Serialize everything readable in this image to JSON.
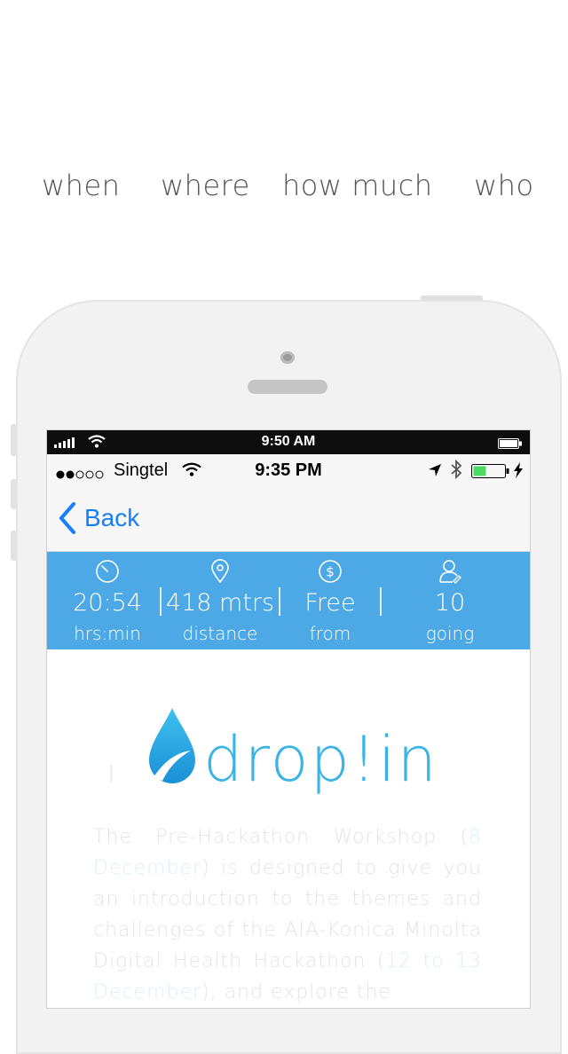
{
  "headline": {
    "items": [
      "when",
      "where",
      "how much",
      "who"
    ]
  },
  "device_statusbar": {
    "time": "9:50 AM"
  },
  "app_statusbar": {
    "carrier": "Singtel",
    "time": "9:35 PM"
  },
  "navbar": {
    "back_label": "Back"
  },
  "stats": [
    {
      "icon": "clock-icon",
      "value": "20:54",
      "label": "hrs:min"
    },
    {
      "icon": "location-pin-icon",
      "value": "418 mtrs",
      "label": "distance"
    },
    {
      "icon": "dollar-coin-icon",
      "value": "Free",
      "label": "from"
    },
    {
      "icon": "person-icon",
      "value": "10",
      "label": "going"
    }
  ],
  "content": {
    "logo_text": "drop!in",
    "description": {
      "p1": "The Pre-Hackathon Workshop (",
      "d1": "8 December",
      "p2": ") is designed to give you an introduction to the themes and challenges of the AIA-Konica Minolta Digital Health Hackathon (",
      "d2": "12 to 13 December",
      "p3": "), and explore the"
    }
  },
  "colors": {
    "accent": "#4ca9e6",
    "link": "#157efb",
    "logo": "#3ab4e8"
  }
}
